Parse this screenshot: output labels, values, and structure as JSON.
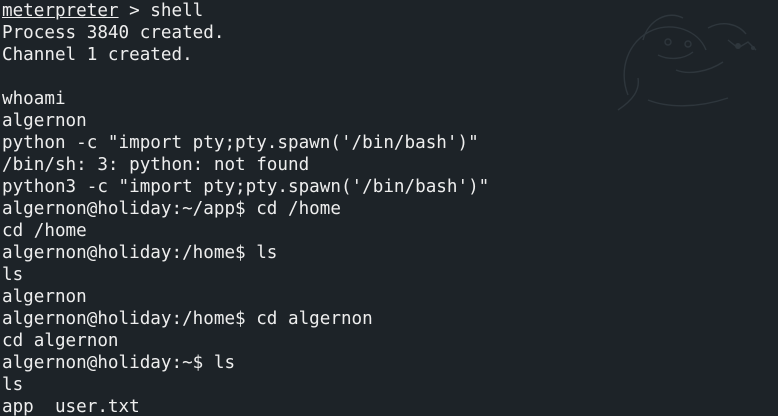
{
  "terminal": {
    "background_color": "#1d2328",
    "text_color": "#eeeeee",
    "prompt_prefix": "meterpreter",
    "prompt_suffix": " > shell",
    "lines": [
      "Process 3840 created.",
      "Channel 1 created.",
      "",
      "whoami",
      "algernon",
      "python -c \"import pty;pty.spawn('/bin/bash')\"",
      "/bin/sh: 3: python: not found",
      "python3 -c \"import pty;pty.spawn('/bin/bash')\"",
      "algernon@holiday:~/app$ cd /home",
      "cd /home",
      "algernon@holiday:/home$ ls",
      "ls",
      "algernon",
      "algernon@holiday:/home$ cd algernon",
      "cd algernon",
      "algernon@holiday:~$ ls",
      "ls",
      "app  user.txt"
    ]
  }
}
